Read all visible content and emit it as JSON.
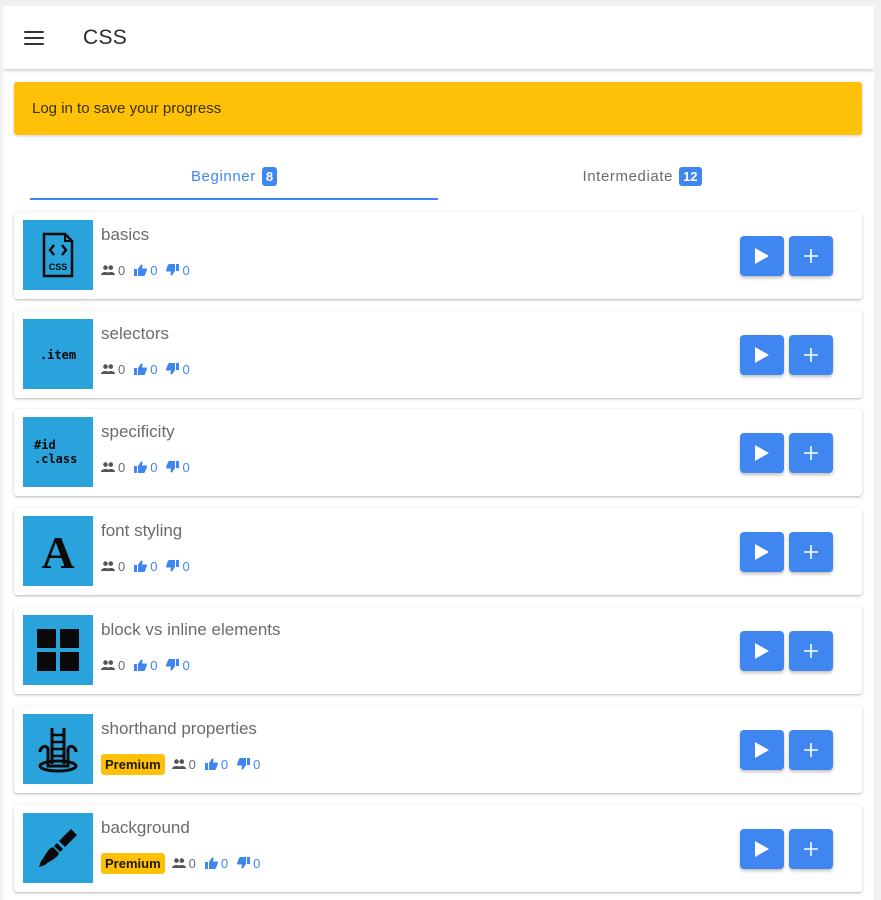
{
  "appbar": {
    "title": "CSS",
    "menu_icon": "hamburger-menu-icon"
  },
  "banner": {
    "text": "Log in to save your progress",
    "color": "#ffc107"
  },
  "tabs": [
    {
      "label": "Beginner",
      "count": "8",
      "active": true
    },
    {
      "label": "Intermediate",
      "count": "12",
      "active": false
    }
  ],
  "colors": {
    "accent": "#3f86f0",
    "thumb_bg": "#2aa3dc",
    "premium": "#ffc107"
  },
  "lessons": [
    {
      "title": "basics",
      "icon": "css-file-icon",
      "premium": false,
      "users": "0",
      "likes": "0",
      "dislikes": "0",
      "thumb_text": "CSS"
    },
    {
      "title": "selectors",
      "icon": "class-selector-icon",
      "premium": false,
      "users": "0",
      "likes": "0",
      "dislikes": "0",
      "thumb_text": ".item"
    },
    {
      "title": "specificity",
      "icon": "id-class-icon",
      "premium": false,
      "users": "0",
      "likes": "0",
      "dislikes": "0",
      "thumb_text": "#id",
      "thumb_text2": ".class"
    },
    {
      "title": "font styling",
      "icon": "font-letter-icon",
      "premium": false,
      "users": "0",
      "likes": "0",
      "dislikes": "0",
      "thumb_text": "A"
    },
    {
      "title": "block vs inline elements",
      "icon": "grid-blocks-icon",
      "premium": false,
      "users": "0",
      "likes": "0",
      "dislikes": "0"
    },
    {
      "title": "shorthand properties",
      "icon": "ladder-bucket-icon",
      "premium": true,
      "premium_label": "Premium",
      "users": "0",
      "likes": "0",
      "dislikes": "0"
    },
    {
      "title": "background",
      "icon": "paint-brush-icon",
      "premium": true,
      "premium_label": "Premium",
      "users": "0",
      "likes": "0",
      "dislikes": "0"
    }
  ],
  "actions": {
    "play_icon": "play-icon",
    "add_icon": "plus-icon"
  }
}
